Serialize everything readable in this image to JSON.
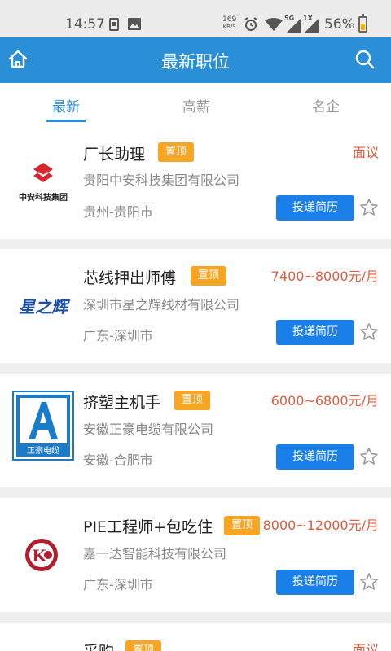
{
  "status_bar": {
    "time": "14:57",
    "net_speed": "169",
    "net_unit": "KB/S",
    "sim": "5G",
    "sim2": "1X",
    "battery": "56%",
    "battery_level": 0.56
  },
  "header": {
    "title": "最新职位",
    "home_icon": "home-icon",
    "search_icon": "search-icon",
    "color": "#2a8fd6"
  },
  "tabs": [
    {
      "label": "最新",
      "active": true
    },
    {
      "label": "高薪",
      "active": false
    },
    {
      "label": "名企",
      "active": false
    }
  ],
  "jobs": [
    {
      "title": "厂长助理",
      "badge": "置顶",
      "salary": "面议",
      "company": "贵阳中安科技集团有限公司",
      "location": "贵州-贵阳市",
      "apply_label": "投递简历",
      "logo_text": "中安科技集团"
    },
    {
      "title": "芯线押出师傅",
      "badge": "置顶",
      "salary": "7400~8000元/月",
      "company": "深圳市星之辉线材有限公司",
      "location": "广东-深圳市",
      "apply_label": "投递简历",
      "logo_text": "星之辉"
    },
    {
      "title": "挤塑主机手",
      "badge": "置顶",
      "salary": "6000~6800元/月",
      "company": "安徽正豪电缆有限公司",
      "location": "安徽-合肥市",
      "apply_label": "投递简历",
      "logo_text": "正豪电缆"
    },
    {
      "title": "PIE工程师+包吃住",
      "badge": "置顶",
      "salary": "8000~12000元/月",
      "company": "嘉一达智能科技有限公司",
      "location": "广东-深圳市",
      "apply_label": "投递简历",
      "logo_text": "K"
    },
    {
      "title": "采购",
      "badge": "置顶",
      "salary": "面议"
    }
  ],
  "colors": {
    "accent": "#2a8fd6",
    "button": "#1a7fe8",
    "badge": "#f6a623",
    "salary": "#e35b3c"
  }
}
